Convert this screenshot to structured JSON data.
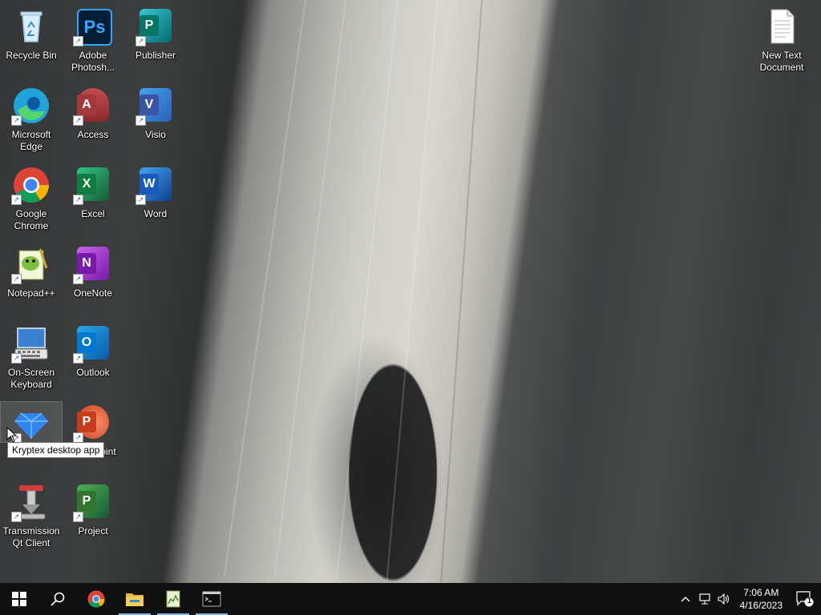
{
  "desktop": {
    "icons": [
      {
        "label": "Recycle Bin"
      },
      {
        "label": "Adobe Photosh..."
      },
      {
        "label": "Publisher"
      },
      {
        "label": "Microsoft Edge"
      },
      {
        "label": "Access"
      },
      {
        "label": "Visio"
      },
      {
        "label": "Google Chrome"
      },
      {
        "label": "Excel"
      },
      {
        "label": "Word"
      },
      {
        "label": "Notepad++"
      },
      {
        "label": "OneNote"
      },
      {
        "label": "On-Screen Keyboard"
      },
      {
        "label": "Outlook"
      },
      {
        "label": "Kryptex desktop app"
      },
      {
        "label": "PowerPoint"
      },
      {
        "label": "Transmission Qt Client"
      },
      {
        "label": "Project"
      },
      {
        "label": "New Text Document"
      }
    ],
    "tooltip": "Kryptex desktop app",
    "powerpoint_visible_fragment": "oint"
  },
  "taskbar": {
    "clock_time": "7:06 AM",
    "clock_date": "4/16/2023",
    "notification_count": "1",
    "apps": [
      {
        "name": "start-icon"
      },
      {
        "name": "search-icon"
      },
      {
        "name": "chrome-icon"
      },
      {
        "name": "file-explorer-icon"
      },
      {
        "name": "kryptex-app-icon"
      },
      {
        "name": "command-prompt-icon"
      }
    ]
  },
  "colors": {
    "taskbar": "#101010",
    "accent": "#76b9ed",
    "word": "#2b579a",
    "excel": "#217346",
    "powerpoint": "#d24726",
    "onenote": "#7719aa",
    "outlook": "#0078d4",
    "access": "#a4373a",
    "publisher": "#077568",
    "visio": "#3955a3",
    "project": "#31752f"
  }
}
